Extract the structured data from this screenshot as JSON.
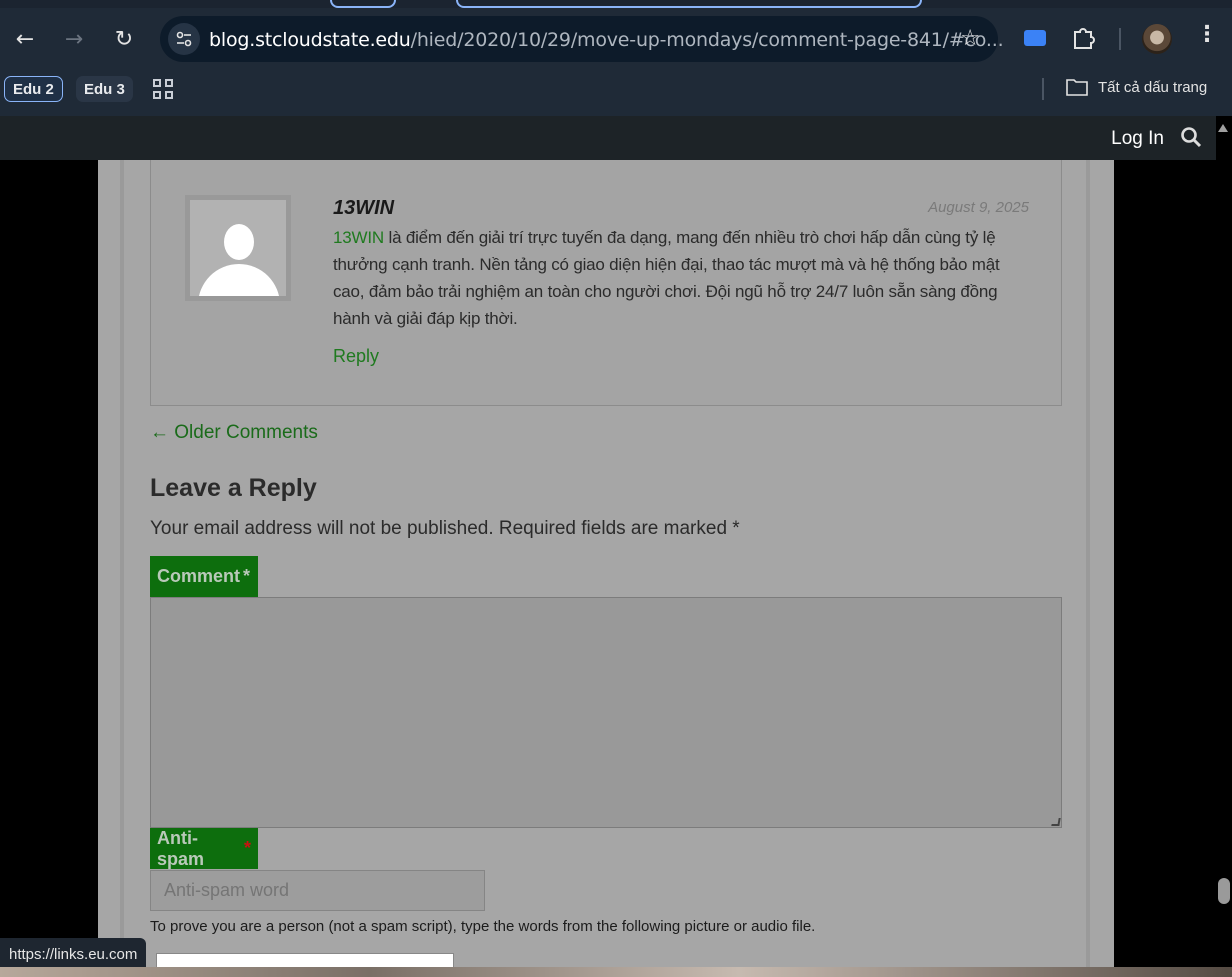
{
  "browser": {
    "url_host": "blog.stcloudstate.edu",
    "url_path": "/hied/2020/10/29/move-up-mondays/comment-page-841/#co...",
    "bookmarks": [
      {
        "label": "Edu 2"
      },
      {
        "label": "Edu 3"
      }
    ],
    "all_bookmarks_label": "Tất cả dấu trang",
    "status_url": "https://links.eu.com"
  },
  "admin_bar": {
    "login_label": "Log In"
  },
  "comment": {
    "author": "13WIN",
    "date": "August 9, 2025",
    "link_text": "13WIN",
    "body": " là điểm đến giải trí trực tuyến đa dạng, mang đến nhiều trò chơi hấp dẫn cùng tỷ lệ thưởng cạnh tranh. Nền tảng có giao diện hiện đại, thao tác mượt mà và hệ thống bảo mật cao, đảm bảo trải nghiệm an toàn cho người chơi. Đội ngũ hỗ trợ 24/7 luôn sẵn sàng đồng hành và giải đáp kịp thời.",
    "reply_label": "Reply"
  },
  "pagination": {
    "older_comments": "← Older Comments"
  },
  "reply_form": {
    "heading": "Leave a Reply",
    "email_note": "Your email address will not be published. Required fields are marked *",
    "comment_label": "Comment",
    "required_mark": "*",
    "antispam_label": "Anti-spam",
    "antispam_placeholder": "Anti-spam word",
    "prove_text": "To prove you are a person (not a spam script), type the words from the following picture or audio file."
  },
  "colors": {
    "link_green": "#1f7a1f",
    "label_bg": "#0d6e0d",
    "admin_bar": "#1d2327"
  }
}
